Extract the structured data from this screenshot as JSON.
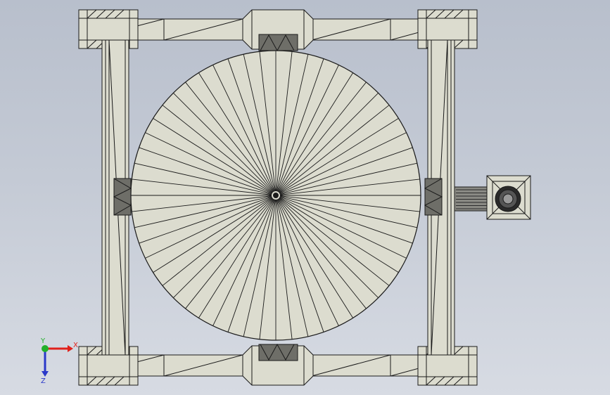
{
  "viewport": {
    "background_top": "#b8bfcc",
    "background_bottom": "#d7dbe3"
  },
  "model": {
    "part_fill": "#dcdccf",
    "part_stroke": "#1a1a1a",
    "dark_block_fill": "#6e6e68",
    "wheel_spoke_count": 56
  },
  "triad": {
    "x_label": "X",
    "y_label": "Y",
    "z_label": "Z",
    "x_color": "#e0211b",
    "y_color": "#22b02a",
    "z_color": "#2a38c9"
  }
}
